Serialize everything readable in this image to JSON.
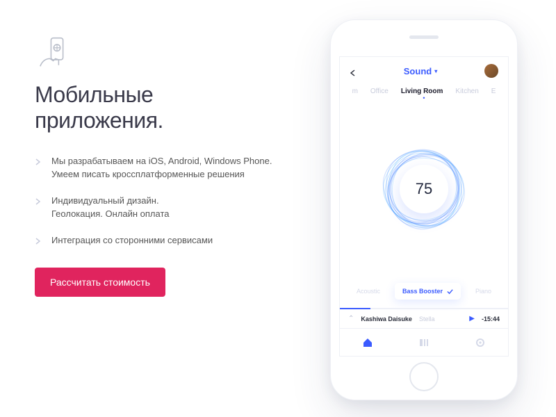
{
  "page": {
    "title_line1": "Мобильные",
    "title_line2": "приложения.",
    "features": [
      {
        "line1": "Мы разрабатываем на iOS, Android, Windows Phone.",
        "line2": "Умеем писать кроссплатформенные решения"
      },
      {
        "line1": "Индивидуальный дизайн.",
        "line2": "Геолокация. Онлайн оплата"
      },
      {
        "line1": "Интеграция со сторонними сервисами",
        "line2": ""
      }
    ],
    "cta_label": "Рассчитать стоимость"
  },
  "app": {
    "header_title": "Sound",
    "rooms": {
      "left_partial": "m",
      "office": "Office",
      "living": "Living Room",
      "kitchen": "Kitchen",
      "right_partial": "E"
    },
    "volume": "75",
    "presets": {
      "left": "Acoustic",
      "center": "Bass Booster",
      "right": "Piano"
    },
    "nowplaying": {
      "artist": "Kashiwa Daisuke",
      "track": "Stella",
      "time": "-15:44"
    }
  },
  "colors": {
    "accent": "#3b5bff",
    "cta": "#e0245e"
  }
}
